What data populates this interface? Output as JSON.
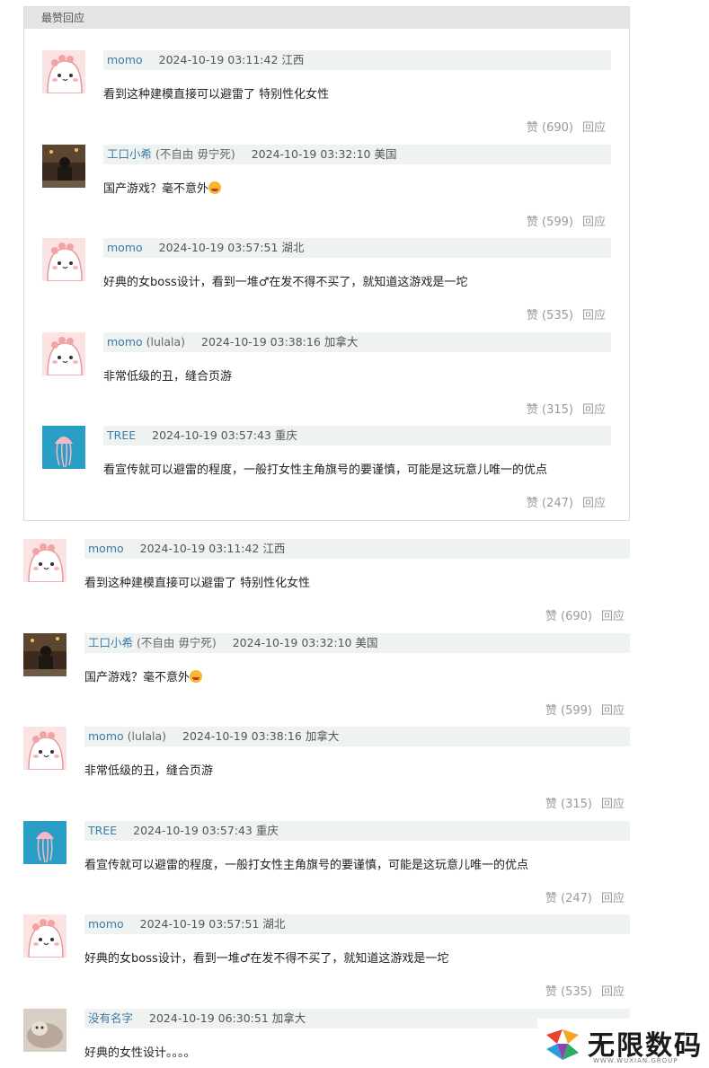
{
  "hot_section": {
    "title": "最赞回应",
    "comments": [
      {
        "user": "momo",
        "extra": "",
        "time": "2024-10-19 03:11:42",
        "location": "江西",
        "text": "看到这种建模直接可以避雷了 特别性化女性",
        "emoji": false,
        "likes": "赞 (690)",
        "reply": "回应",
        "avatar": "pink-creature"
      },
      {
        "user": "工口小希",
        "extra": " (不自由 毋宁死)",
        "time": "2024-10-19 03:32:10",
        "location": "美国",
        "text": "国产游戏？毫不意外",
        "emoji": true,
        "likes": "赞 (599)",
        "reply": "回应",
        "avatar": "dark-photo"
      },
      {
        "user": "momo",
        "extra": "",
        "time": "2024-10-19 03:57:51",
        "location": "湖北",
        "text": "好典的女boss设计，看到一堆♂在发不得不买了，就知道这游戏是一坨",
        "emoji": false,
        "likes": "赞 (535)",
        "reply": "回应",
        "avatar": "pink-creature"
      },
      {
        "user": "momo",
        "extra": " (lulala)",
        "time": "2024-10-19 03:38:16",
        "location": "加拿大",
        "text": "非常低级的丑，缝合页游",
        "emoji": false,
        "likes": "赞 (315)",
        "reply": "回应",
        "avatar": "pink-creature"
      },
      {
        "user": "TREE",
        "extra": "",
        "time": "2024-10-19 03:57:43",
        "location": "重庆",
        "text": "看宣传就可以避雷的程度，一般打女性主角旗号的要谨慎，可能是这玩意儿唯一的优点",
        "emoji": false,
        "likes": "赞 (247)",
        "reply": "回应",
        "avatar": "jellyfish"
      }
    ]
  },
  "all_comments": [
    {
      "user": "momo",
      "extra": "",
      "time": "2024-10-19 03:11:42",
      "location": "江西",
      "text": "看到这种建模直接可以避雷了 特别性化女性",
      "emoji": false,
      "likes": "赞 (690)",
      "reply": "回应",
      "avatar": "pink-creature"
    },
    {
      "user": "工口小希",
      "extra": " (不自由 毋宁死)",
      "time": "2024-10-19 03:32:10",
      "location": "美国",
      "text": "国产游戏？毫不意外",
      "emoji": true,
      "likes": "赞 (599)",
      "reply": "回应",
      "avatar": "dark-photo"
    },
    {
      "user": "momo",
      "extra": " (lulala)",
      "time": "2024-10-19 03:38:16",
      "location": "加拿大",
      "text": "非常低级的丑，缝合页游",
      "emoji": false,
      "likes": "赞 (315)",
      "reply": "回应",
      "avatar": "pink-creature"
    },
    {
      "user": "TREE",
      "extra": "",
      "time": "2024-10-19 03:57:43",
      "location": "重庆",
      "text": "看宣传就可以避雷的程度，一般打女性主角旗号的要谨慎，可能是这玩意儿唯一的优点",
      "emoji": false,
      "likes": "赞 (247)",
      "reply": "回应",
      "avatar": "jellyfish"
    },
    {
      "user": "momo",
      "extra": "",
      "time": "2024-10-19 03:57:51",
      "location": "湖北",
      "text": "好典的女boss设计，看到一堆♂在发不得不买了，就知道这游戏是一坨",
      "emoji": false,
      "likes": "赞 (535)",
      "reply": "回应",
      "avatar": "pink-creature"
    },
    {
      "user": "没有名字",
      "extra": "",
      "time": "2024-10-19 06:30:51",
      "location": "加拿大",
      "text": "好典的女性设计。。。。",
      "emoji": false,
      "likes": "",
      "reply": "",
      "avatar": "cat-photo"
    }
  ],
  "watermark": {
    "title": "无限数码",
    "subtitle": "WWW.WUXIAN.GROUP"
  },
  "colors": {
    "username": "#3c7aa4",
    "meta_bg": "#eef3f1",
    "header_bg": "#e5e5e5",
    "muted": "#999999"
  }
}
